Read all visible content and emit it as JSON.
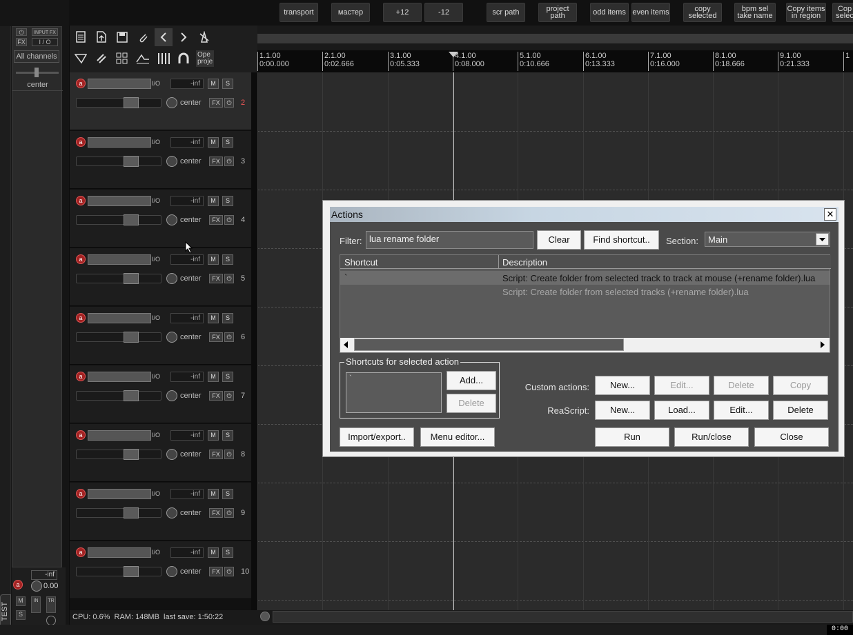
{
  "toolbar": {
    "buttons": [
      "transport",
      "мастер",
      "+12",
      "-12",
      "scr path",
      "project\npath",
      "odd items",
      "even items",
      "copy\nselected",
      "bpm sel\ntake name",
      "Copy items\nin region",
      "Cop\nselec"
    ]
  },
  "master": {
    "input_fx": "INPUT FX",
    "fx": "FX",
    "io": "I / O",
    "channels": "All channels",
    "pan": "center",
    "vol_bottom": "-inf",
    "vol_value": "0.00",
    "m": "M",
    "s": "S",
    "in": "IN",
    "tr": "TR",
    "test_tab": "TEST"
  },
  "main_toolbar": {
    "open_project": "Ope\nproje"
  },
  "tracks": [
    {
      "number": "2",
      "vol": "-inf",
      "pan": "center",
      "io": "I/O",
      "arm": "a",
      "m": "M",
      "s": "S",
      "fx": "FX",
      "selected": true
    },
    {
      "number": "3",
      "vol": "-inf",
      "pan": "center",
      "io": "I/O",
      "arm": "a",
      "m": "M",
      "s": "S",
      "fx": "FX"
    },
    {
      "number": "4",
      "vol": "-inf",
      "pan": "center",
      "io": "I/O",
      "arm": "a",
      "m": "M",
      "s": "S",
      "fx": "FX"
    },
    {
      "number": "5",
      "vol": "-inf",
      "pan": "center",
      "io": "I/O",
      "arm": "a",
      "m": "M",
      "s": "S",
      "fx": "FX"
    },
    {
      "number": "6",
      "vol": "-inf",
      "pan": "center",
      "io": "I/O",
      "arm": "a",
      "m": "M",
      "s": "S",
      "fx": "FX"
    },
    {
      "number": "7",
      "vol": "-inf",
      "pan": "center",
      "io": "I/O",
      "arm": "a",
      "m": "M",
      "s": "S",
      "fx": "FX"
    },
    {
      "number": "8",
      "vol": "-inf",
      "pan": "center",
      "io": "I/O",
      "arm": "a",
      "m": "M",
      "s": "S",
      "fx": "FX"
    },
    {
      "number": "9",
      "vol": "-inf",
      "pan": "center",
      "io": "I/O",
      "arm": "a",
      "m": "M",
      "s": "S",
      "fx": "FX"
    },
    {
      "number": "10",
      "vol": "-inf",
      "pan": "center",
      "io": "I/O",
      "arm": "a",
      "m": "M",
      "s": "S",
      "fx": "FX"
    }
  ],
  "ruler": [
    {
      "bar": "1.1.00",
      "time": "0:00.000"
    },
    {
      "bar": "2.1.00",
      "time": "0:02.666"
    },
    {
      "bar": "3.1.00",
      "time": "0:05.333"
    },
    {
      "bar": "4.1.00",
      "time": "0:08.000"
    },
    {
      "bar": "5.1.00",
      "time": "0:10.666"
    },
    {
      "bar": "6.1.00",
      "time": "0:13.333"
    },
    {
      "bar": "7.1.00",
      "time": "0:16.000"
    },
    {
      "bar": "8.1.00",
      "time": "0:18.666"
    },
    {
      "bar": "9.1.00",
      "time": "0:21.333"
    },
    {
      "bar": "1",
      "time": ""
    }
  ],
  "status": {
    "text": "CPU: 0.6%  RAM: 148MB  last save: 1:50:22",
    "clock": "0:00"
  },
  "actions": {
    "title": "Actions",
    "close_x": "✕",
    "filter_label": "Filter:",
    "filter_value": "lua rename folder",
    "clear": "Clear",
    "find_shortcut": "Find shortcut..",
    "section_label": "Section:",
    "section_value": "Main",
    "col_shortcut": "Shortcut",
    "col_description": "Description",
    "rows": [
      {
        "shortcut": "`",
        "description": "Script: Create folder from selected track to track at mouse (+rename folder).lua",
        "selected": true
      },
      {
        "shortcut": "",
        "description": "Script: Create folder from selected tracks (+rename folder).lua"
      }
    ],
    "shortcuts_group": "Shortcuts for selected action",
    "shortcut_entry": "`",
    "add": "Add...",
    "delete": "Delete",
    "custom_actions_label": "Custom actions:",
    "reascript_label": "ReaScript:",
    "custom_new": "New...",
    "custom_edit": "Edit...",
    "custom_delete": "Delete",
    "custom_copy": "Copy",
    "rs_new": "New...",
    "rs_load": "Load...",
    "rs_edit": "Edit...",
    "rs_delete": "Delete",
    "import_export": "Import/export..",
    "menu_editor": "Menu editor...",
    "run": "Run",
    "run_close": "Run/close",
    "close": "Close"
  }
}
